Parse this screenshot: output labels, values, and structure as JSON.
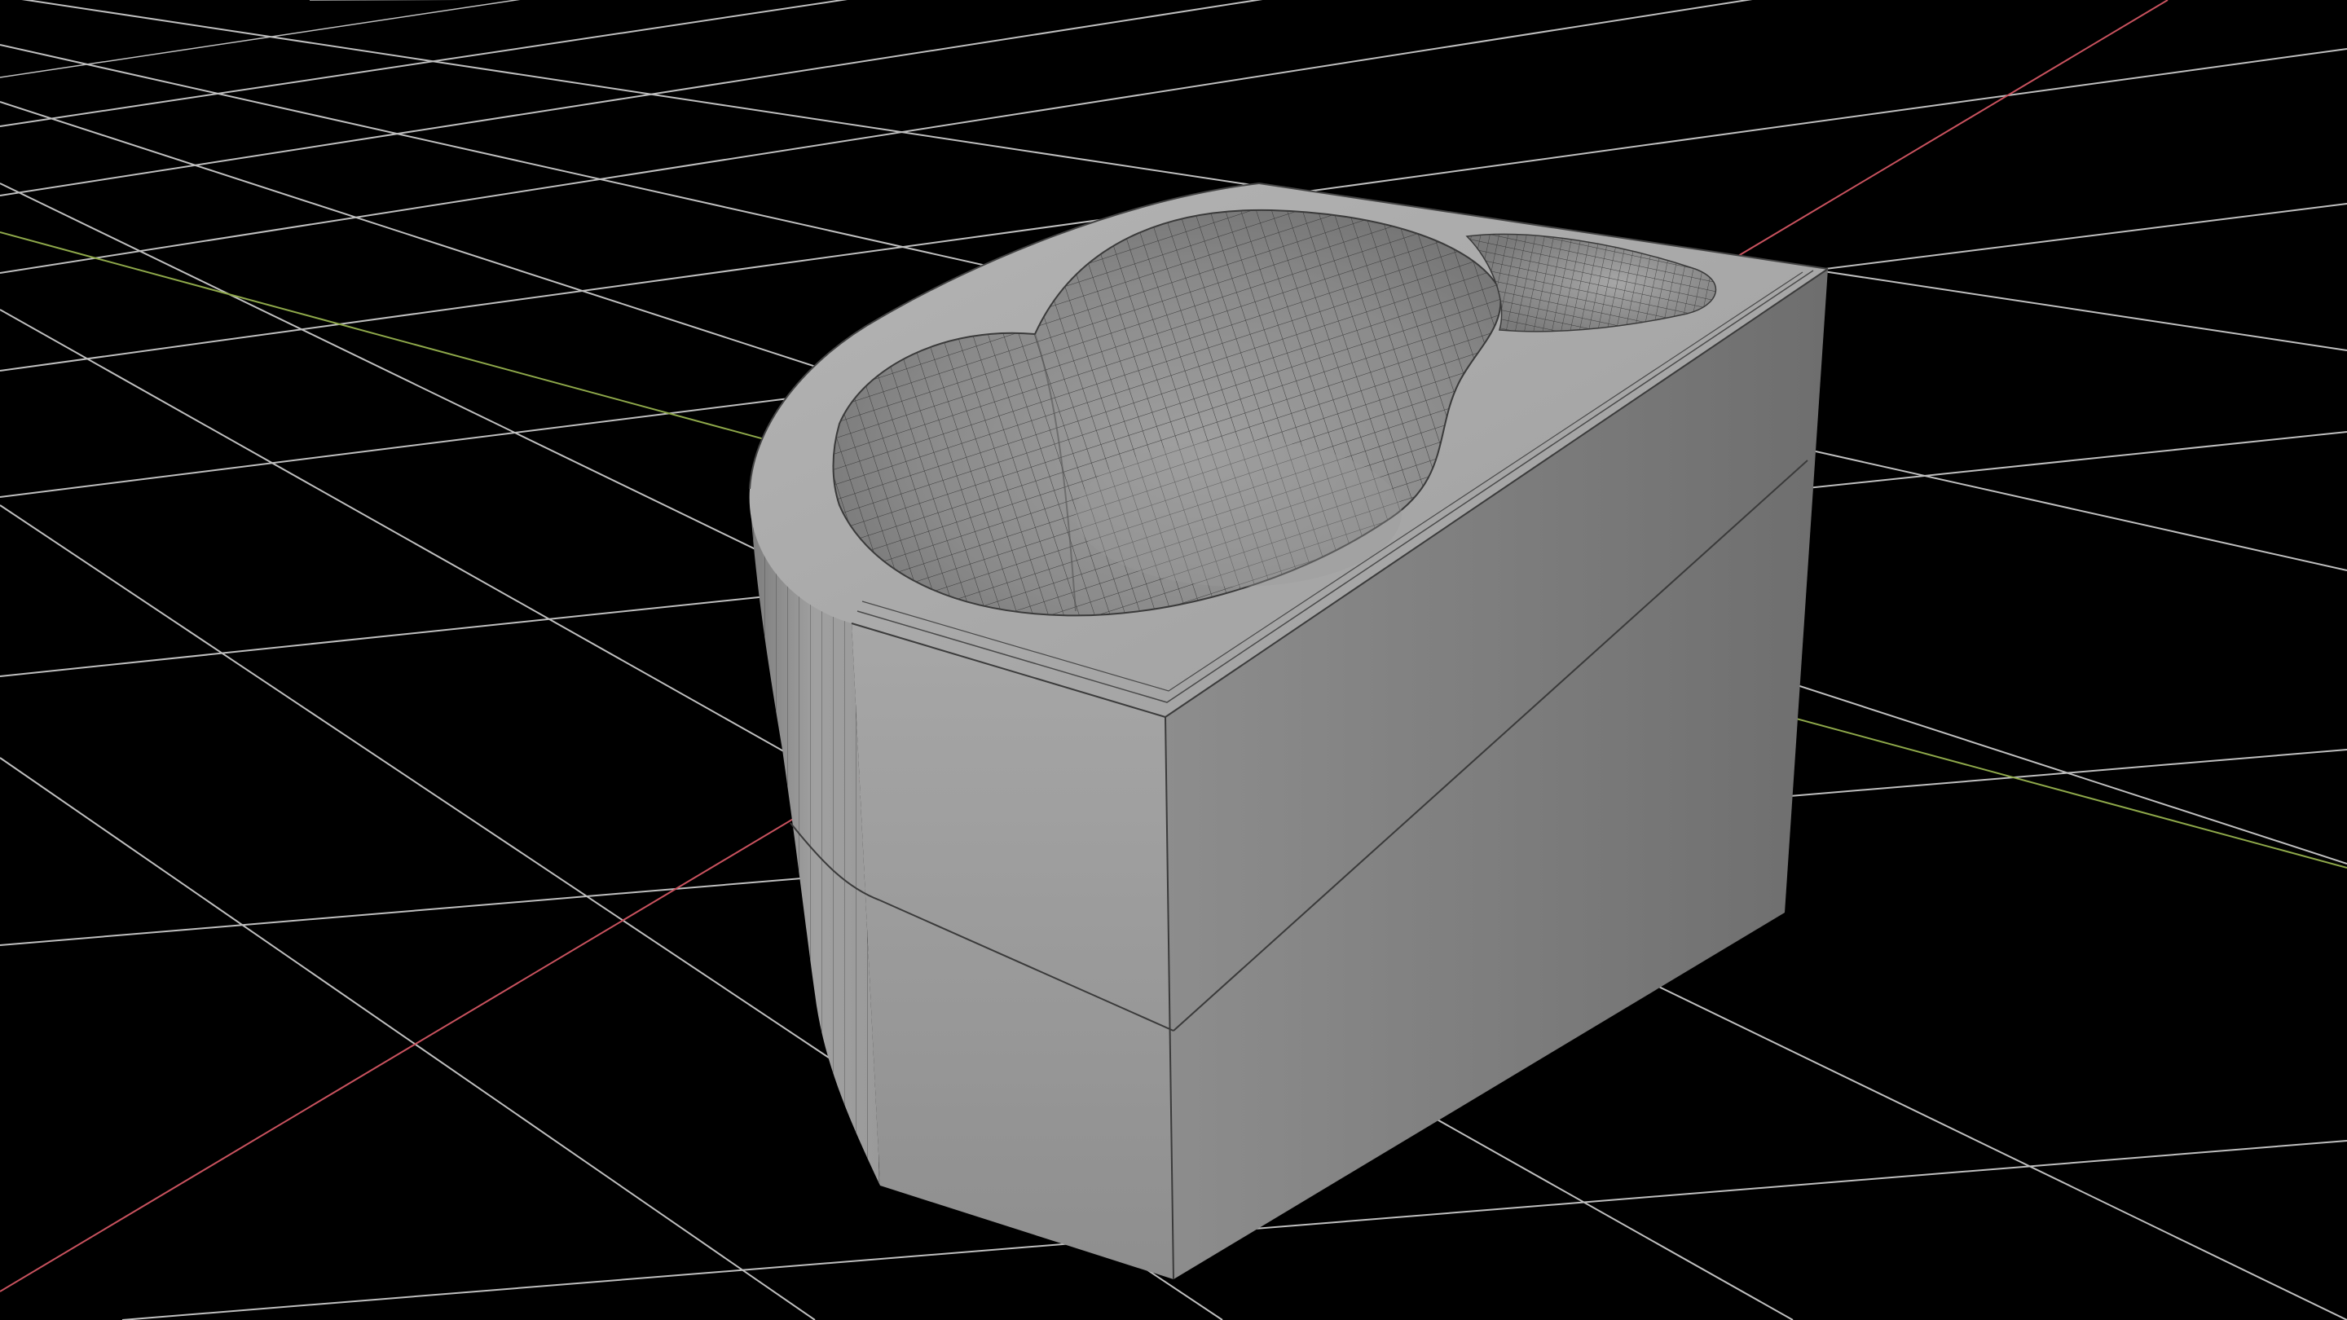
{
  "viewport": {
    "mode": "3d-viewport",
    "background_color": "#000000"
  },
  "grid": {
    "visible": true,
    "line_color": "#bfbfbf",
    "x_axis_color": "#c8525e",
    "y_axis_color": "#8ea84a"
  },
  "mesh": {
    "object": "corner-bathtub",
    "wireframe_overlay": true,
    "shading": "solid",
    "colors": {
      "top_surface": "#a9a9a9",
      "front_face": "#9a9a9a",
      "side_face": "#838383",
      "curved_face": "#959595",
      "basin_interior": "#8c8c8c",
      "wire": "#303030"
    }
  }
}
